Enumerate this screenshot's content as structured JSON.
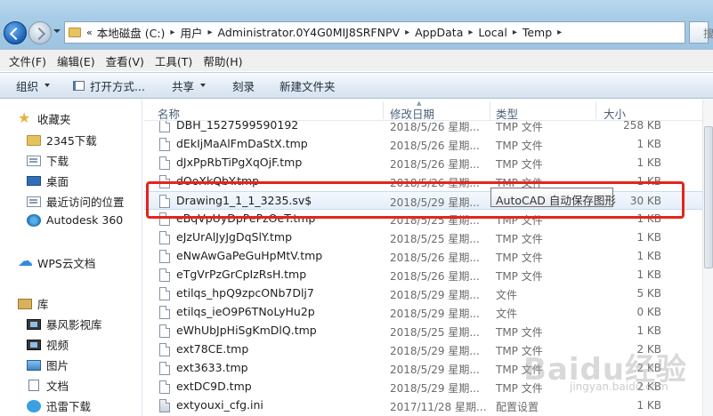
{
  "address": {
    "lead": "«",
    "segments": [
      "本地磁盘 (C:)",
      "用户",
      "Administrator.0Y4G0MIJ8SRFNPV",
      "AppData",
      "Local",
      "Temp"
    ],
    "search_stub": "搜"
  },
  "menu": [
    "文件(F)",
    "编辑(E)",
    "查看(V)",
    "工具(T)",
    "帮助(H)"
  ],
  "toolbar": {
    "organize": "组织",
    "open_with": "打开方式...",
    "share": "共享",
    "burn": "刻录",
    "new_folder": "新建文件夹"
  },
  "nav": {
    "favorites": "收藏夹",
    "items": [
      "2345下载",
      "下载",
      "桌面",
      "最近访问的位置",
      "Autodesk 360"
    ],
    "wps": "WPS云文档",
    "library": "库",
    "library_items": [
      "暴风影视库",
      "视频",
      "图片",
      "文档",
      "迅雷下载"
    ]
  },
  "columns": {
    "name": "名称",
    "date": "修改日期",
    "type": "类型",
    "size": "大小"
  },
  "files": [
    {
      "name": "DBH_1527599590192",
      "date": "2018/5/26 星期...",
      "type": "TMP 文件",
      "size": "258 KB",
      "icon": "file-icon"
    },
    {
      "name": "dEkIjMaAlFmDaStX.tmp",
      "date": "2018/5/26 星期...",
      "type": "TMP 文件",
      "size": "1 KB",
      "icon": "file-icon"
    },
    {
      "name": "dJxPpRbTiPgXqOjF.tmp",
      "date": "2018/5/26 星期...",
      "type": "TMP 文件",
      "size": "1 KB",
      "icon": "file-icon"
    },
    {
      "name": "dOoXkQbY.tmp",
      "date": "2018/5/26 星期...",
      "type": "TMP 文件",
      "size": "1 KB",
      "icon": "file-icon"
    },
    {
      "name": "Drawing1_1_1_3235.sv$",
      "date": "2018/5/29 星期...",
      "type": "AutoCAD 自动保存图形",
      "size": "30 KB",
      "icon": "file-icon",
      "selected": true
    },
    {
      "name": "eBqVpUyDpPePzOeT.tmp",
      "date": "2018/5/25 星期...",
      "type": "TMP 文件",
      "size": "1 KB",
      "icon": "file-icon"
    },
    {
      "name": "eJzUrAlJyJgDqSlY.tmp",
      "date": "2018/5/25 星期...",
      "type": "TMP 文件",
      "size": "1 KB",
      "icon": "file-icon"
    },
    {
      "name": "eNwAwGaPeGuHpMtV.tmp",
      "date": "2018/5/26 星期...",
      "type": "TMP 文件",
      "size": "1 KB",
      "icon": "file-icon"
    },
    {
      "name": "eTgVrPzGrCpIzRsH.tmp",
      "date": "2018/5/26 星期...",
      "type": "TMP 文件",
      "size": "1 KB",
      "icon": "file-icon"
    },
    {
      "name": "etilqs_hpQ9zpcONb7Dlj7",
      "date": "2018/5/29 星期...",
      "type": "文件",
      "size": "5 KB",
      "icon": "file-icon"
    },
    {
      "name": "etilqs_ieO9P6TNoLyHu2p",
      "date": "2018/5/29 星期...",
      "type": "文件",
      "size": "0 KB",
      "icon": "file-icon"
    },
    {
      "name": "eWhUbJpHiSgKmDlQ.tmp",
      "date": "2018/5/25 星期...",
      "type": "TMP 文件",
      "size": "1 KB",
      "icon": "file-icon"
    },
    {
      "name": "ext78CE.tmp",
      "date": "2018/5/29 星期...",
      "type": "TMP 文件",
      "size": "2 KB",
      "icon": "file-icon"
    },
    {
      "name": "ext3633.tmp",
      "date": "2018/5/29 星期...",
      "type": "TMP 文件",
      "size": "2 KB",
      "icon": "file-icon"
    },
    {
      "name": "extDC9D.tmp",
      "date": "2018/5/29 星期...",
      "type": "TMP 文件",
      "size": "2 KB",
      "icon": "file-icon"
    },
    {
      "name": "extyouxi_cfg.ini",
      "date": "2017/11/28 星期...",
      "type": "配置设置",
      "size": "1 KB",
      "icon": "config-file-icon"
    }
  ],
  "tooltip": "AutoCAD 自动保存图形",
  "watermark": {
    "main": "Baidu经验",
    "sub": "jingyan.baidu.com"
  },
  "colors": {
    "highlight_box": "#e5241b",
    "address_bar": "#a6cbe6"
  }
}
